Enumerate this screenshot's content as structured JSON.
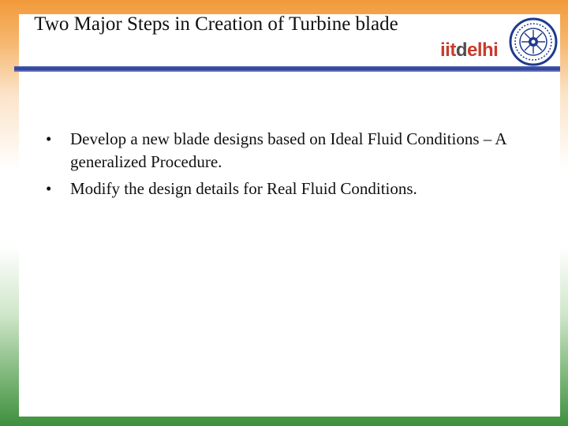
{
  "slide": {
    "title": "Two Major Steps in Creation of Turbine blade",
    "logo": {
      "part1": "iit",
      "part2": "d",
      "part3": "elhi"
    },
    "bullet_symbol": "•",
    "bullets": [
      "Develop a new blade designs based on Ideal Fluid Conditions – A generalized Procedure.",
      "Modify the design details for Real Fluid Conditions."
    ]
  },
  "colors": {
    "rule": "#2d3f92",
    "logo_red": "#c93a2c",
    "logo_gray": "#4d4d4d",
    "border_top": "#f29a3a",
    "border_bottom": "#3e8f3e"
  },
  "icons": {
    "emblem": "iit-delhi-seal-icon"
  }
}
